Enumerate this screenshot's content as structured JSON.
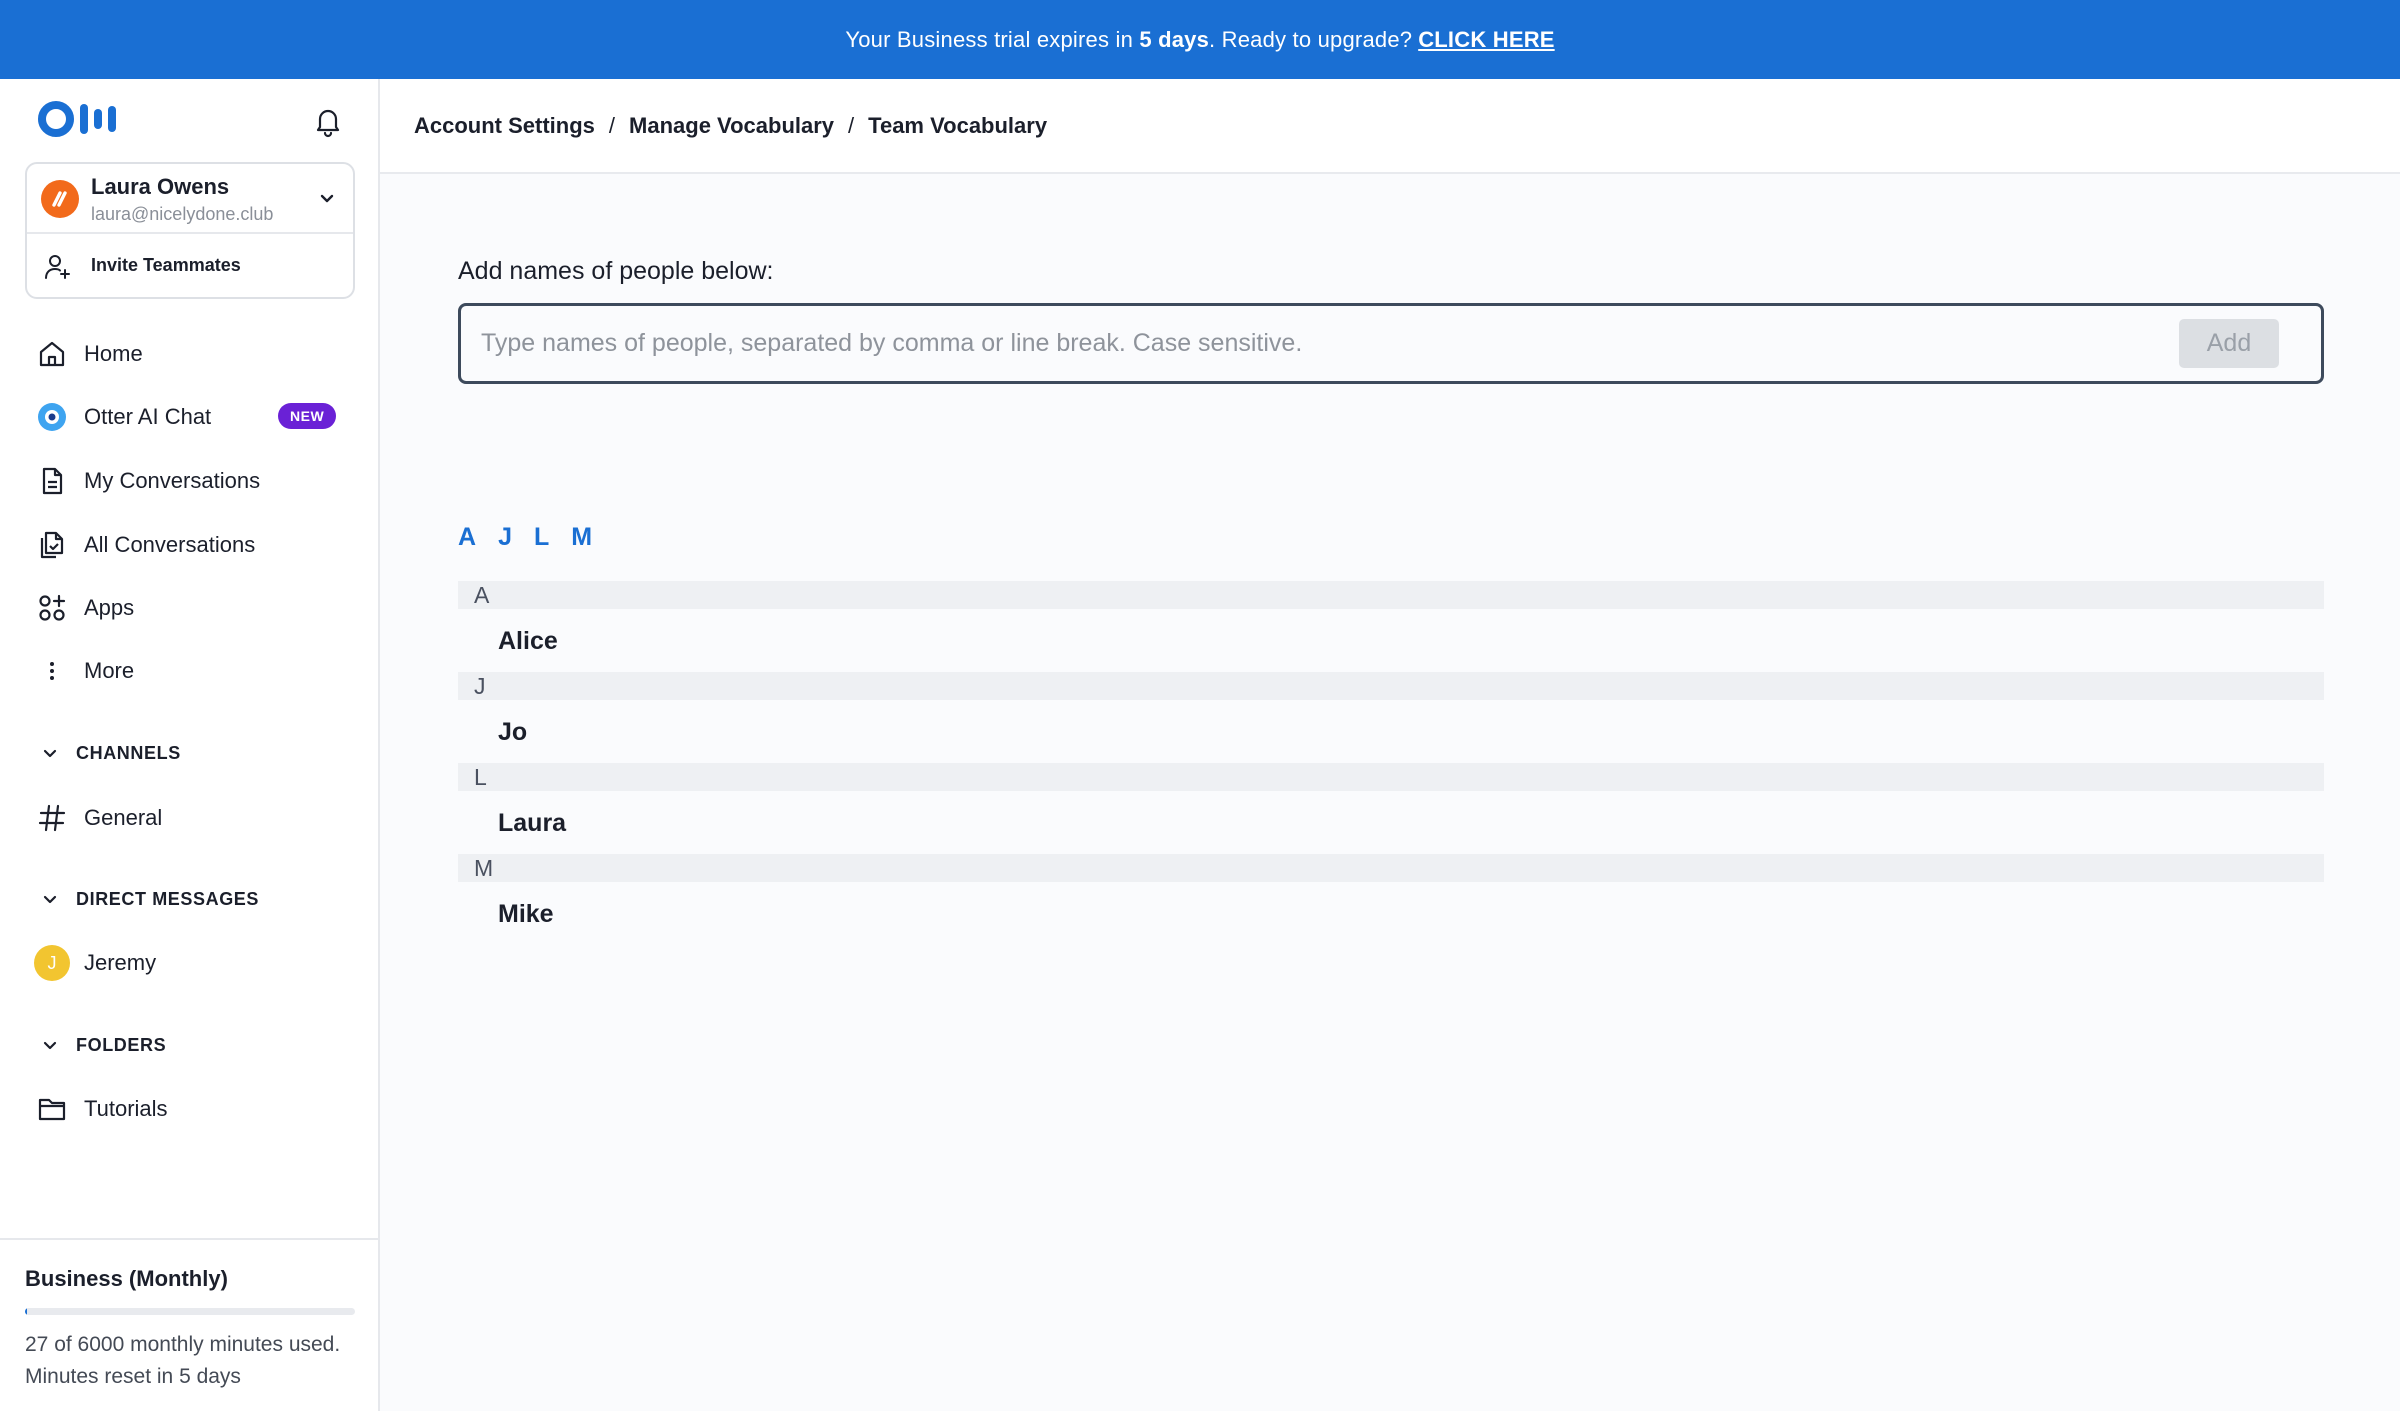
{
  "banner": {
    "text_before": "Your Business trial expires in ",
    "days": "5 days",
    "text_after": ". Ready to upgrade?",
    "cta": "CLICK HERE",
    "color": "#1a6fd3"
  },
  "sidebar": {
    "logo_icon": "otter-logo",
    "notifications_icon": "bell-icon",
    "account": {
      "name": "Laura Owens",
      "email": "laura@nicelydone.club",
      "avatar_color": "#f26a1b"
    },
    "invite_label": "Invite Teammates",
    "nav": [
      {
        "label": "Home",
        "icon": "home-icon"
      },
      {
        "label": "Otter AI Chat",
        "icon": "otter-chat-icon",
        "badge": "NEW"
      },
      {
        "label": "My Conversations",
        "icon": "document-icon"
      },
      {
        "label": "All Conversations",
        "icon": "documents-icon"
      },
      {
        "label": "Apps",
        "icon": "apps-icon"
      },
      {
        "label": "More",
        "icon": "more-vertical-icon"
      }
    ],
    "channels": {
      "heading": "CHANNELS",
      "items": [
        {
          "label": "General",
          "icon": "hash-icon"
        }
      ]
    },
    "direct_messages": {
      "heading": "DIRECT MESSAGES",
      "items": [
        {
          "label": "Jeremy",
          "initial": "J",
          "avatar_color": "#f2c530"
        }
      ]
    },
    "folders": {
      "heading": "FOLDERS",
      "items": [
        {
          "label": "Tutorials",
          "icon": "folder-icon"
        }
      ]
    },
    "plan": {
      "title": "Business (Monthly)",
      "minutes_used": 27,
      "minutes_total": 6000,
      "usage_text": "27 of 6000 monthly minutes used. Minutes reset in 5 days"
    }
  },
  "breadcrumb": [
    "Account Settings",
    "Manage Vocabulary",
    "Team Vocabulary"
  ],
  "breadcrumb_separator": "/",
  "vocabulary": {
    "add_label": "Add names of people below:",
    "input_placeholder": "Type names of people, separated by comma or line break. Case sensitive.",
    "input_value": "",
    "add_button": "Add",
    "alphabet_nav": [
      "A",
      "J",
      "L",
      "M"
    ],
    "groups": [
      {
        "letter": "A",
        "names": [
          "Alice"
        ]
      },
      {
        "letter": "J",
        "names": [
          "Jo"
        ]
      },
      {
        "letter": "L",
        "names": [
          "Laura"
        ]
      },
      {
        "letter": "M",
        "names": [
          "Mike"
        ]
      }
    ]
  }
}
